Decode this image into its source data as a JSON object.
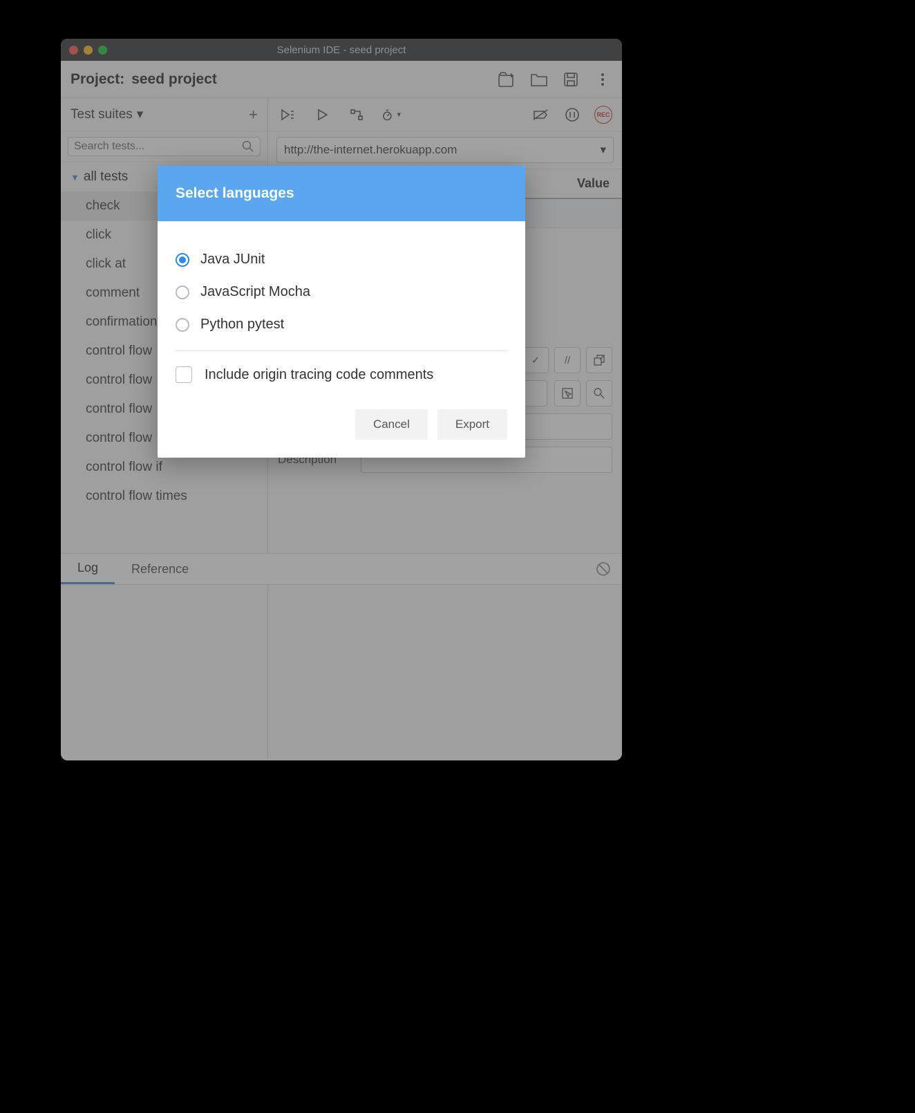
{
  "window": {
    "title": "Selenium IDE - seed project"
  },
  "project": {
    "label": "Project:",
    "name": "seed project"
  },
  "sidebar": {
    "suites_label": "Test suites",
    "search_placeholder": "Search tests...",
    "group": "all tests",
    "tests": [
      "check",
      "click",
      "click at",
      "comment",
      "confirmation",
      "control flow",
      "control flow",
      "control flow",
      "control flow",
      "control flow if",
      "control flow times"
    ]
  },
  "main": {
    "url": "http://the-internet.herokuapp.com",
    "col_value": "Value",
    "detail_description": "Description"
  },
  "tabs": {
    "log": "Log",
    "reference": "Reference"
  },
  "modal": {
    "title": "Select languages",
    "options": [
      "Java JUnit",
      "JavaScript Mocha",
      "Python pytest"
    ],
    "checkbox_label": "Include origin tracing code comments",
    "cancel": "Cancel",
    "export": "Export"
  }
}
